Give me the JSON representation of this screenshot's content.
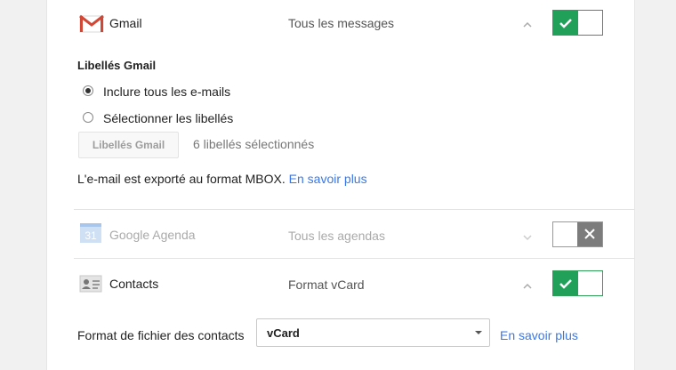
{
  "services": [
    {
      "name": "Gmail",
      "description": "Tous les messages",
      "icon": "gmail-icon",
      "enabled": true
    },
    {
      "name": "Google Agenda",
      "description": "Tous les agendas",
      "icon": "calendar-icon",
      "icon_text": "31",
      "enabled": false
    },
    {
      "name": "Contacts",
      "description": "Format vCard",
      "icon": "contacts-icon",
      "enabled": true
    }
  ],
  "gmail_options": {
    "section_title": "Libellés Gmail",
    "radio_all": "Inclure tous les e-mails",
    "radio_select": "Sélectionner les libellés",
    "selected_radio": "all",
    "labels_button": "Libellés Gmail",
    "selected_count": "6 libellés sélectionnés",
    "export_note": "L'e-mail est exporté au format MBOX.",
    "learn_more": "En savoir plus"
  },
  "contacts_options": {
    "format_label": "Format de fichier des contacts",
    "format_value": "vCard",
    "learn_more": "En savoir plus"
  },
  "colors": {
    "toggle_on": "#20a058",
    "toggle_off": "#7c7c7c",
    "link": "#3b78e7"
  }
}
